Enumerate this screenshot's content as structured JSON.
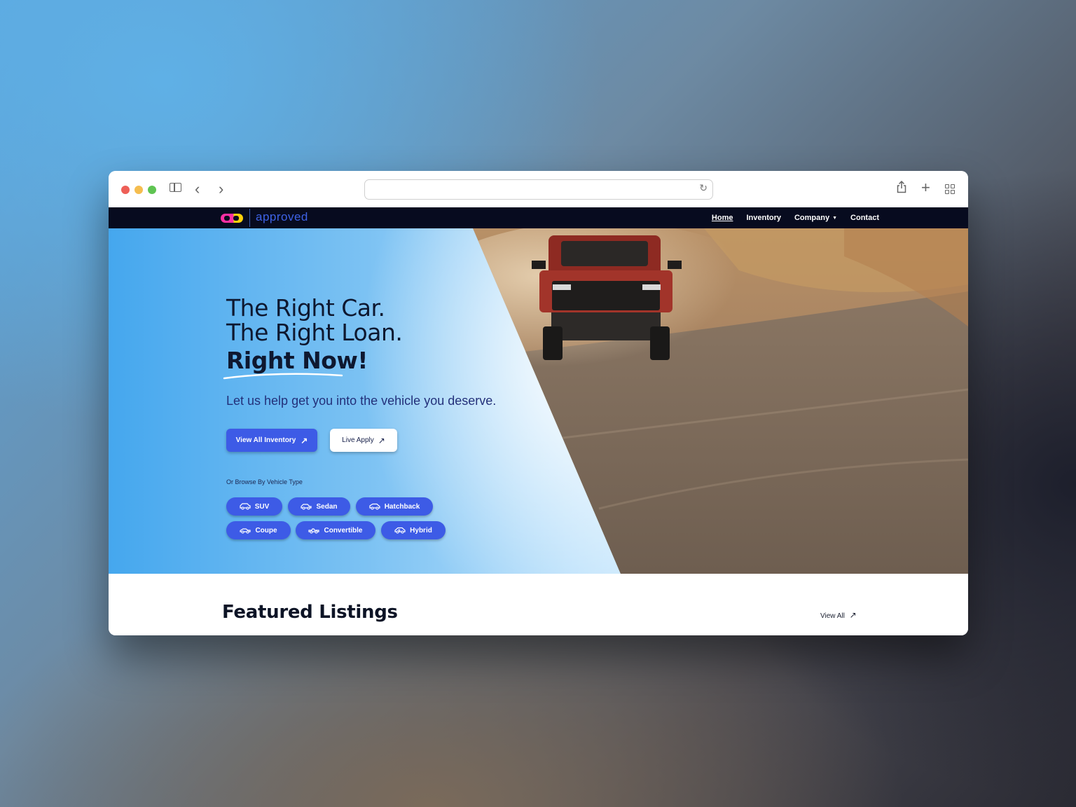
{
  "browser": {
    "url": "",
    "icons": [
      "sidebar-icon",
      "back-icon",
      "forward-icon",
      "reload-icon",
      "share-icon",
      "new-tab-icon",
      "tab-overview-icon"
    ]
  },
  "nav": {
    "logo_text": "approved",
    "links": [
      "Home",
      "Inventory",
      "Company",
      "Contact"
    ]
  },
  "hero": {
    "line1": "The Right Car.",
    "line2": "The Right Loan.",
    "line3": "Right Now!",
    "subtitle": "Let us help get you into the vehicle you deserve.",
    "primary_button": "View All Inventory",
    "secondary_button": "Live Apply",
    "browse_label": "Or Browse By Vehicle Type",
    "vehicle_types": [
      "SUV",
      "Sedan",
      "Hatchback",
      "Coupe",
      "Convertible",
      "Hybrid"
    ]
  },
  "featured": {
    "title": "Featured Listings",
    "view_all": "View All"
  },
  "colors": {
    "accent": "#3d5be6",
    "nav_bg": "#070b1f",
    "hero_left": "#45a7ee"
  }
}
